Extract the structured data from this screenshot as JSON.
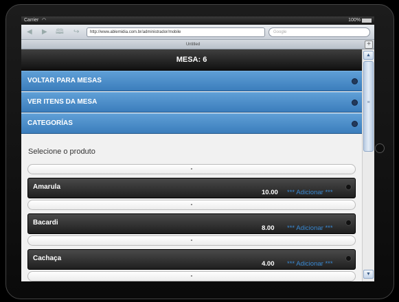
{
  "status": {
    "carrier": "Carrier",
    "battery": "100%"
  },
  "browser": {
    "url": "http://www.ablemidia.com.br/administrador/mobile",
    "search_placeholder": "Google",
    "tab_title": "Untitled",
    "tab_add": "+"
  },
  "page": {
    "header": "MESA: 6",
    "menu": [
      {
        "label": "VOLTAR PARA MESAS"
      },
      {
        "label": "VER ITENS DA MESA"
      },
      {
        "label": "CATEGORÍAS"
      }
    ],
    "select_label": "Selecione o produto",
    "separator": "-",
    "products": [
      {
        "name": "Amarula",
        "price": "10.00",
        "action": "*** Adicionar ***"
      },
      {
        "name": "Bacardi",
        "price": "8.00",
        "action": "*** Adicionar ***"
      },
      {
        "name": "Cachaça",
        "price": "4.00",
        "action": "*** Adicionar ***"
      }
    ]
  },
  "icons": {
    "back": "back-arrow-icon",
    "forward": "forward-arrow-icon",
    "bookmarks": "book-icon",
    "share": "share-icon",
    "wifi": "wifi-icon",
    "battery": "battery-icon"
  },
  "colors": {
    "accent_blue": "#3b7dbc",
    "add_link": "#3a8ad4",
    "header_dark": "#111111"
  }
}
